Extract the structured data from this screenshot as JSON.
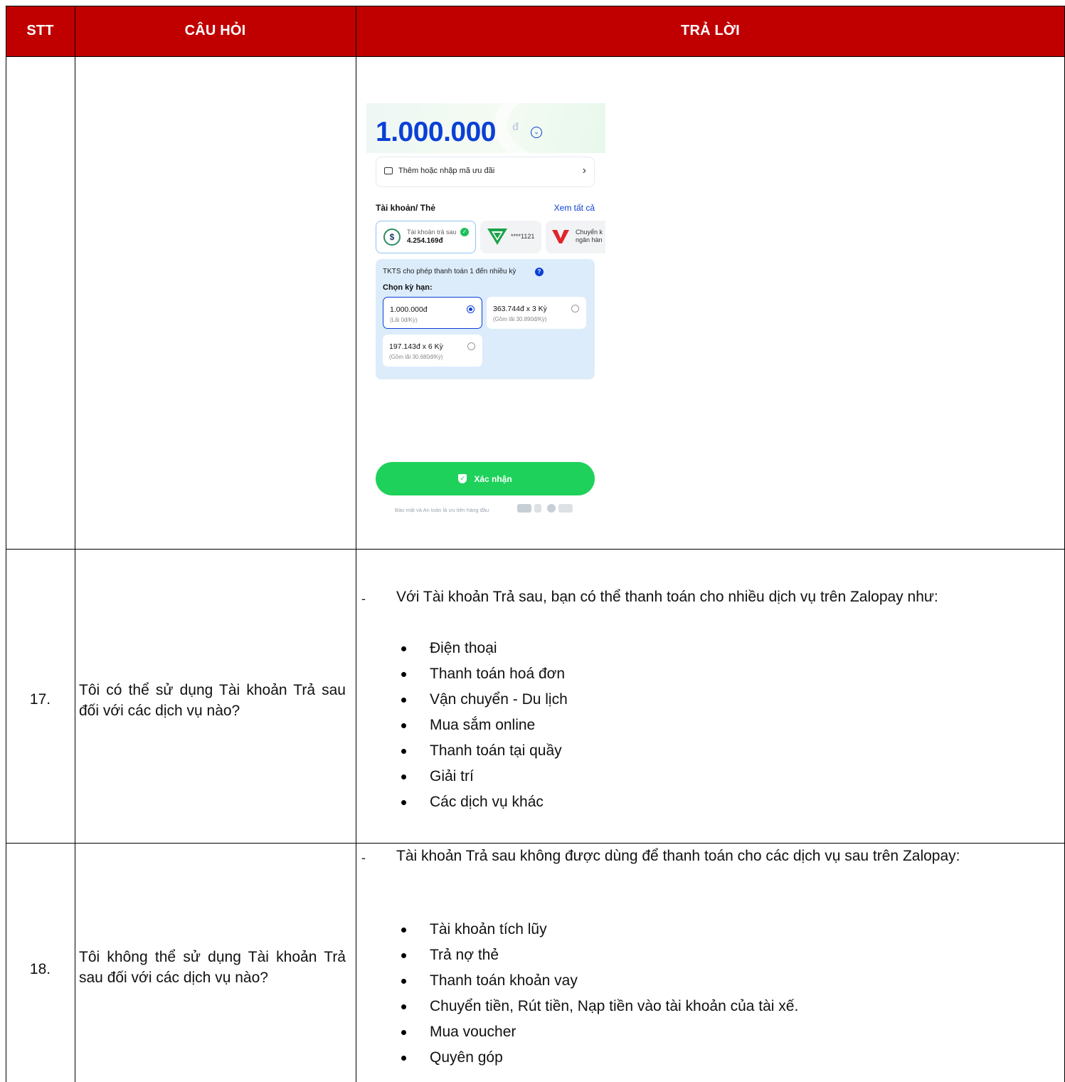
{
  "header": {
    "col_stt": "STT",
    "col_question": "CÂU HỎI",
    "col_answer": "TRẢ LỜI",
    "background": "#c00000"
  },
  "screenshot": {
    "amount": "1.000.000",
    "currency_symbol": "đ",
    "promo_label": "Thêm hoặc nhập mã ưu đãi",
    "accounts_title": "Tài khoản/ Thẻ",
    "see_all": "Xem tất cả",
    "card1_label": "Tài khoản trả sau",
    "card1_balance": "4.254.169đ",
    "card2_number": "****1121",
    "card3_line1": "Chuyển k",
    "card3_line2": "ngân hàn",
    "panel_info": "TKTS cho phép thanh toán 1 đến nhiều kỳ",
    "panel_title": "Chọn kỳ hạn:",
    "options": [
      {
        "main": "1.000.000đ",
        "sub": "(Lãi 0đ/Kỳ)",
        "selected": true
      },
      {
        "main": "363.744đ x 3 Kỳ",
        "sub": "(Gồm lãi 30.890đ/Kỳ)",
        "selected": false
      },
      {
        "main": "197.143đ x 6 Kỳ",
        "sub": "(Gồm lãi 30.680đ/Kỳ)",
        "selected": false
      }
    ],
    "confirm_label": "Xác nhận",
    "security_note": "Bảo mật và An toàn là ưu tiên hàng đầu",
    "accent": "#0b3fd6",
    "confirm_color": "#1ed15b"
  },
  "rows": [
    {
      "stt": "17.",
      "question": "Tôi có thể sử dụng Tài khoản Trả sau đối với các dịch vụ nào?",
      "dash": "-",
      "intro": "Với Tài khoản Trả sau, bạn có thể thanh toán cho nhiều dịch vụ trên Zalopay như:",
      "items": [
        "Điện thoại",
        "Thanh toán hoá đơn",
        "Vận chuyển - Du lịch",
        "Mua sắm online",
        "Thanh toán tại quầy",
        "Giải trí",
        "Các dịch vụ khác"
      ]
    },
    {
      "stt": "18.",
      "question": "Tôi không thể sử dụng Tài khoản Trả sau đối với các dịch vụ nào?",
      "dash": "-",
      "intro": "Tài khoản Trả sau không được dùng để thanh toán cho các dịch vụ sau trên Zalopay:",
      "items": [
        "Tài khoản tích lũy",
        "Trả nợ thẻ",
        "Thanh toán khoản vay",
        "Chuyển tiền, Rút tiền, Nạp tiền vào tài khoản của tài xế.",
        "Mua voucher",
        "Quyên góp"
      ]
    }
  ]
}
